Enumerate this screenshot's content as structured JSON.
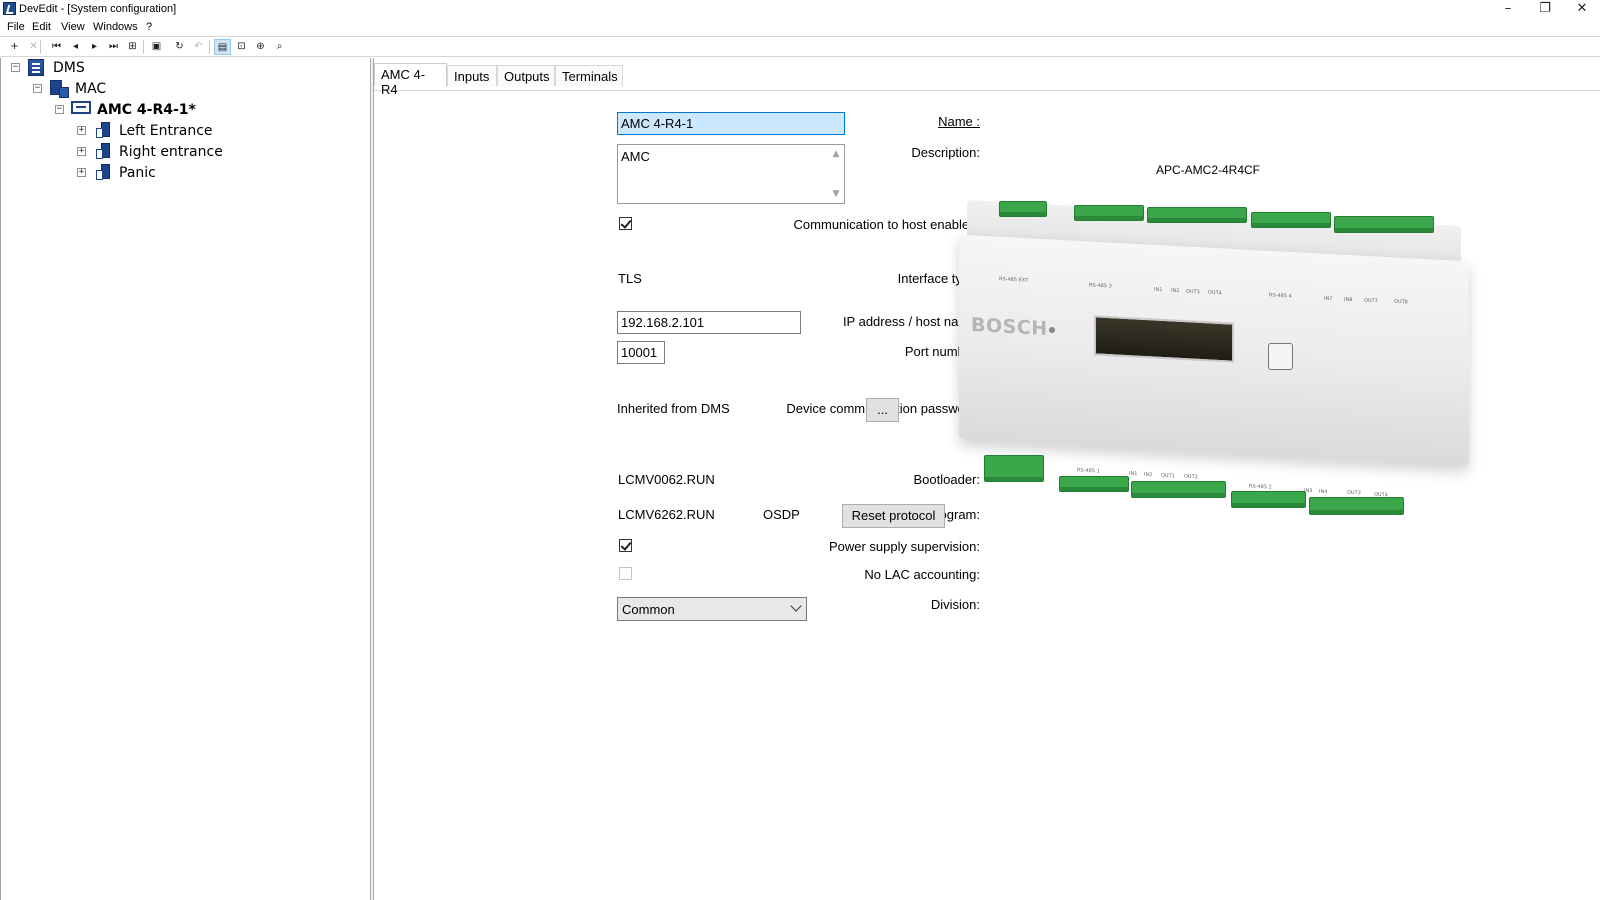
{
  "window": {
    "title": "DevEdit - [System configuration]",
    "controls": {
      "minimize": "–",
      "maximize": "❐",
      "close": "✕"
    }
  },
  "menu": [
    "File",
    "Edit",
    "View",
    "Windows",
    "?"
  ],
  "toolbar": [
    {
      "icon": "add-icon",
      "glyph": "+"
    },
    {
      "icon": "delete-icon",
      "glyph": "✕",
      "disabled": true
    },
    {
      "icon": "first-record-icon",
      "glyph": "⏮"
    },
    {
      "icon": "previous-record-icon",
      "glyph": "◂"
    },
    {
      "icon": "next-record-icon",
      "glyph": "▸"
    },
    {
      "icon": "last-record-icon",
      "glyph": "⏭"
    },
    {
      "icon": "tree-view-icon",
      "glyph": "⊞"
    },
    {
      "icon": "save-icon",
      "glyph": "▣"
    },
    {
      "icon": "refresh-icon",
      "glyph": "↻"
    },
    {
      "icon": "undo-icon",
      "glyph": "↶",
      "disabled": true
    },
    {
      "icon": "device-view-icon",
      "glyph": "▤",
      "active": true
    },
    {
      "icon": "network-view-icon",
      "glyph": "⊡"
    },
    {
      "icon": "target-icon",
      "glyph": "⊕"
    },
    {
      "icon": "search-icon",
      "glyph": "⌕"
    }
  ],
  "tree": {
    "nodes": [
      {
        "label": "DMS",
        "expanded": true,
        "icon": "dms-server-icon"
      },
      {
        "label": "MAC",
        "expanded": true,
        "icon": "mac-icon"
      },
      {
        "label": "AMC 4-R4-1*",
        "expanded": true,
        "icon": "amc-controller-icon",
        "selected": true
      },
      {
        "label": "Left Entrance",
        "expanded": false,
        "icon": "door-icon"
      },
      {
        "label": "Right entrance",
        "expanded": false,
        "icon": "door-icon"
      },
      {
        "label": "Panic",
        "expanded": false,
        "icon": "door-icon"
      }
    ],
    "toggle_expanded": "−",
    "toggle_collapsed": "+"
  },
  "tabs": [
    "AMC 4-R4",
    "Inputs",
    "Outputs",
    "Terminals"
  ],
  "active_tab": 0,
  "form": {
    "name_label": "Name :",
    "name_value": "AMC 4-R4-1",
    "description_label": "Description:",
    "description_value": "AMC",
    "comm_host_label": "Communication to host enabled:",
    "comm_host_checked": true,
    "interface_type_label": "Interface type:",
    "interface_type_value": "TLS",
    "ip_label": "IP address / host name:",
    "ip_value": "192.168.2.101",
    "port_label": "Port number:",
    "port_value": "10001",
    "password_label": "Device communication password:",
    "password_value": "Inherited from DMS",
    "password_button": "...",
    "bootloader_label": "Bootloader:",
    "bootloader_value": "LCMV0062.RUN",
    "program_label": "Program:",
    "program_value": "LCMV6262.RUN",
    "protocol_value": "OSDP",
    "reset_protocol_button": "Reset protocol",
    "power_supply_label": "Power supply supervision:",
    "power_supply_checked": true,
    "no_lac_label": "No LAC accounting:",
    "no_lac_checked": false,
    "division_label": "Division:",
    "division_value": "Common"
  },
  "device": {
    "model": "APC-AMC2-4R4CF",
    "brand": "BOSCH",
    "top_labels": [
      "RS-485 EXT",
      "RS-485 3",
      "IN1",
      "IN2",
      "OUT3",
      "OUT4",
      "RS-485 4",
      "IN7",
      "IN8",
      "OUT7",
      "OUT8"
    ],
    "bottom_labels": [
      "RS-485 1",
      "IN1",
      "IN2",
      "OUT1",
      "OUT2",
      "RS-485 2",
      "IN3",
      "IN4",
      "OUT3",
      "OUT4"
    ]
  },
  "colors": {
    "selection_blue": "#cce8ff",
    "focus_border": "#0078d7",
    "terminal_green": "#3aa84a",
    "tree_icon_blue": "#1d4389"
  }
}
